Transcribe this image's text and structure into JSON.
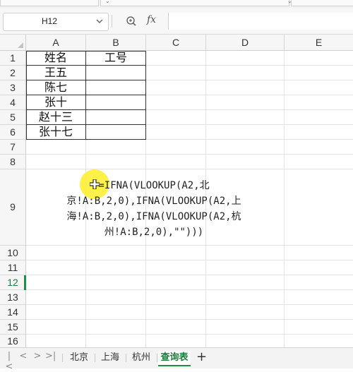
{
  "namebox": {
    "value": "H12"
  },
  "formula_bar": {
    "zoom_icon": "zoom-icon",
    "fx_label": "fx",
    "content": ""
  },
  "columns": [
    "A",
    "B",
    "C",
    "D",
    "E"
  ],
  "rows": [
    "1",
    "2",
    "3",
    "4",
    "5",
    "6",
    "7",
    "8",
    "9",
    "10",
    "11",
    "12",
    "13",
    "14",
    "15",
    "16"
  ],
  "selected_row": "12",
  "table": {
    "header_name": "姓名",
    "header_id": "工号",
    "names": [
      "王五",
      "陈七",
      "张十",
      "赵十三",
      "张十七"
    ]
  },
  "formula_display": {
    "line1": "=IFNA(VLOOKUP(A2,北",
    "line2": "京!A:B,2,0),IFNA(VLOOKUP(A2,上",
    "line3": "海!A:B,2,0),IFNA(VLOOKUP(A2,杭",
    "line4": "州!A:B,2,0),\"\")))"
  },
  "sheets": {
    "nav": [
      "|<",
      "<",
      ">",
      ">|"
    ],
    "tabs": [
      "北京",
      "上海",
      "杭州",
      "查询表"
    ],
    "active": "查询表",
    "add_label": "+"
  },
  "colors": {
    "accent": "#1d8f45",
    "highlight": "#ffee28"
  }
}
